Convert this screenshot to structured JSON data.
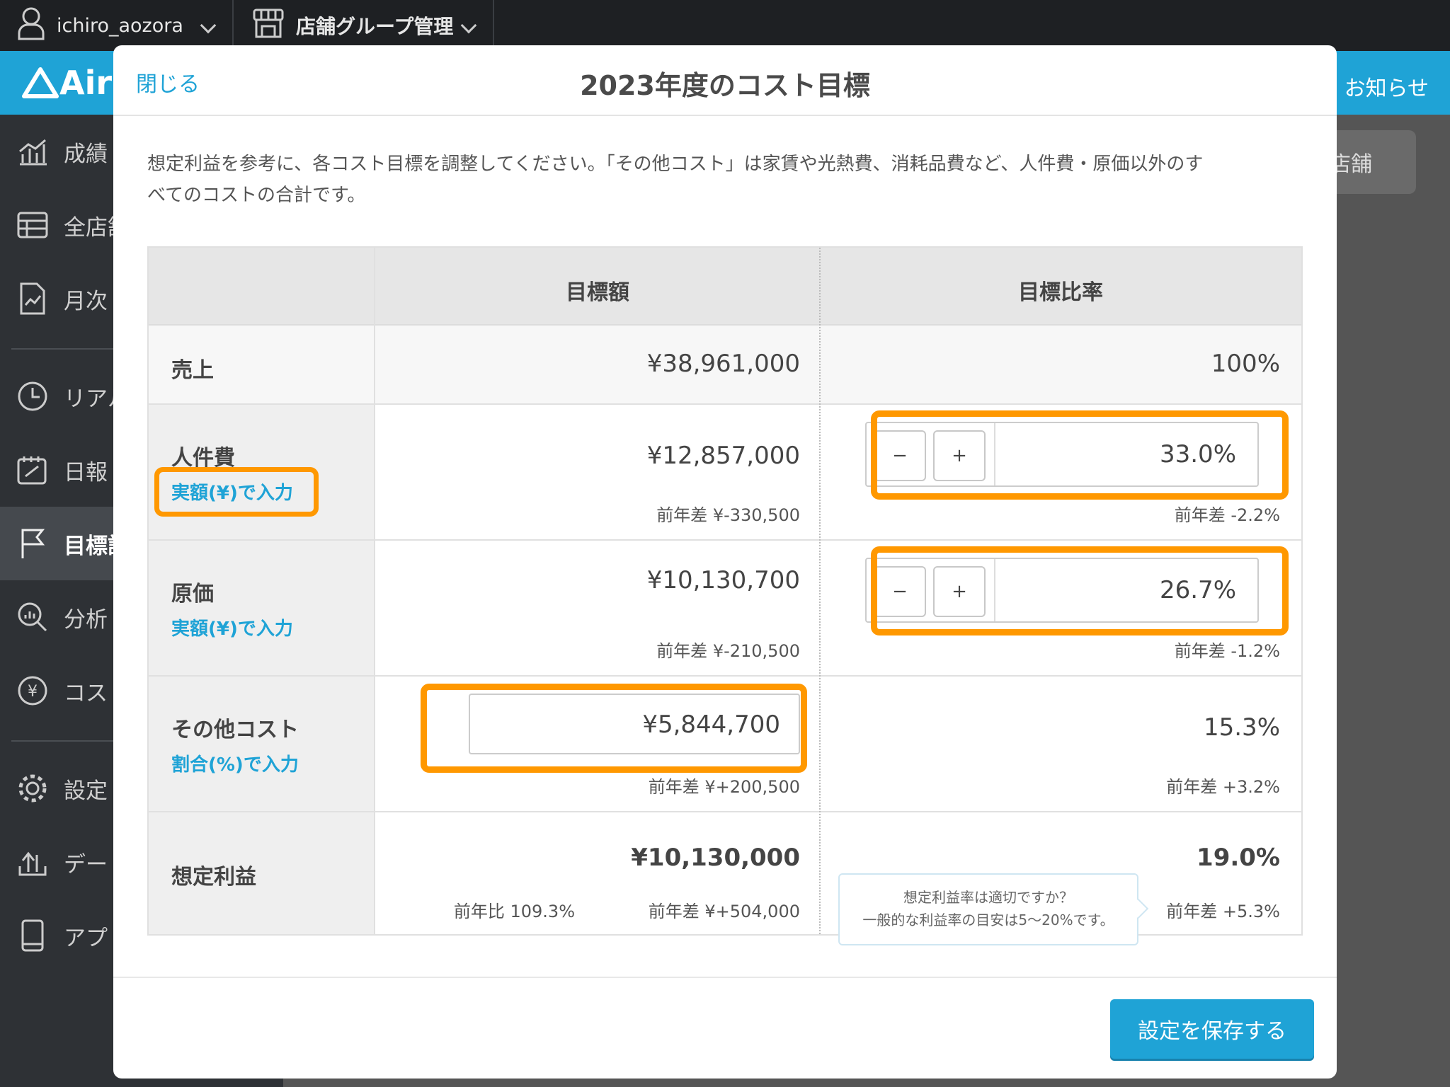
{
  "topbar": {
    "user": "ichiro_aozora",
    "group": "店舗グループ管理"
  },
  "header": {
    "logo": "Airl",
    "notice": "お知らせ"
  },
  "sidebar": {
    "items": [
      {
        "label": "成績",
        "icon": "bar-chart-icon"
      },
      {
        "label": "全店舗",
        "icon": "table-icon"
      },
      {
        "label": "月次",
        "icon": "monthly-report-icon"
      },
      {
        "label": "リアル",
        "icon": "clock-icon"
      },
      {
        "label": "日報",
        "icon": "daily-report-icon"
      },
      {
        "label": "目標設",
        "icon": "flag-icon"
      },
      {
        "label": "分析",
        "icon": "analysis-icon"
      },
      {
        "label": "コス",
        "icon": "yen-icon"
      },
      {
        "label": "設定",
        "icon": "gear-icon"
      },
      {
        "label": "デー",
        "icon": "upload-icon"
      },
      {
        "label": "アプ",
        "icon": "phone-icon"
      }
    ]
  },
  "store_button": "店舗",
  "modal": {
    "close": "閉じる",
    "title": "2023年度のコスト目標",
    "desc_line1": "想定利益を参考に、各コスト目標を調整してください。「その他コスト」は家賃や光熱費、消耗品費など、人件費・原価以外のす",
    "desc_line2": "べてのコストの合計です。",
    "table": {
      "col_amount": "目標額",
      "col_rate": "目標比率",
      "sales": {
        "label": "売上",
        "amount": "¥38,961,000",
        "rate": "100%"
      },
      "labor": {
        "label": "人件費",
        "link": "実額(¥)で入力",
        "amount": "¥12,857,000",
        "amount_diff": "前年差 ¥-330,500",
        "rate": "33.0%",
        "rate_diff": "前年差 -2.2%"
      },
      "cost": {
        "label": "原価",
        "link": "実額(¥)で入力",
        "amount": "¥10,130,700",
        "amount_diff": "前年差 ¥-210,500",
        "rate": "26.7%",
        "rate_diff": "前年差 -1.2%"
      },
      "other": {
        "label": "その他コスト",
        "link": "割合(%)で入力",
        "amount": "¥5,844,700",
        "amount_diff": "前年差 ¥+200,500",
        "rate": "15.3%",
        "rate_diff": "前年差 +3.2%"
      },
      "profit": {
        "label": "想定利益",
        "amount": "¥10,130,000",
        "yoy": "前年比 109.3%",
        "amount_diff": "前年差 ¥+504,000",
        "rate": "19.0%",
        "rate_diff": "前年差 +5.3%"
      },
      "minus": "−",
      "plus": "+"
    },
    "tooltip_line1": "想定利益率は適切ですか？",
    "tooltip_line2": "一般的な利益率の目安は5〜20%です。",
    "save": "設定を保存する"
  },
  "colors": {
    "accent": "#1fa3d6",
    "highlight": "#ff9800"
  }
}
